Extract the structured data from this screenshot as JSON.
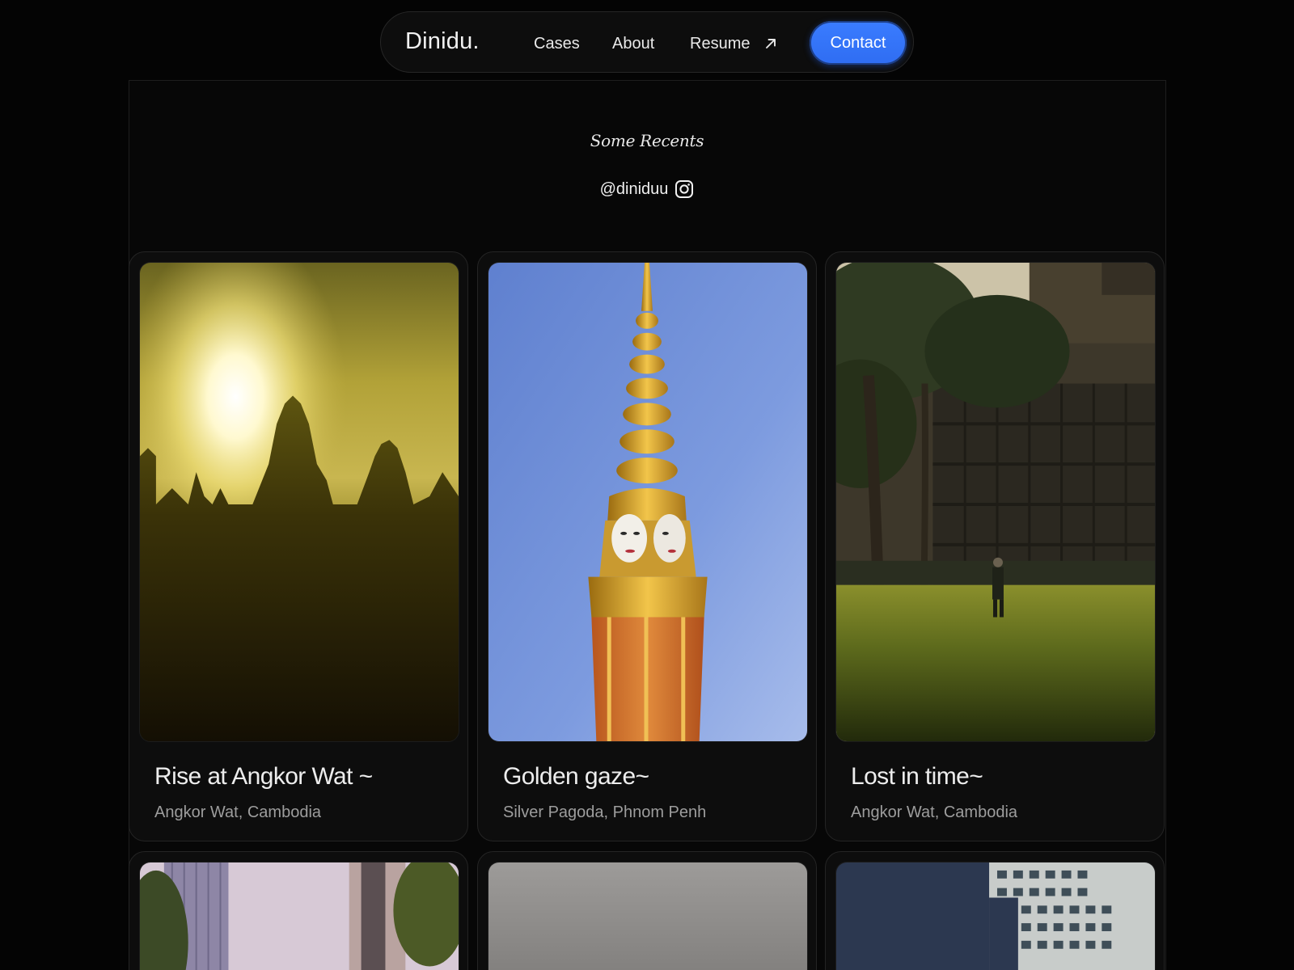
{
  "nav": {
    "brand": "Dinidu.",
    "links": [
      {
        "label": "Cases"
      },
      {
        "label": "About"
      },
      {
        "label": "Resume",
        "icon": "arrow-up-right-icon"
      }
    ],
    "contact_label": "Contact",
    "accent_color": "#3478ff"
  },
  "recents": {
    "title": "Some Recents",
    "handle": "@diniduu",
    "handle_icon": "instagram-icon"
  },
  "photos": [
    {
      "title": "Rise at Angkor Wat ~",
      "location": "Angkor Wat, Cambodia"
    },
    {
      "title": "Golden gaze~",
      "location": "Silver Pagoda, Phnom Penh"
    },
    {
      "title": "Lost in time~",
      "location": "Angkor Wat, Cambodia"
    }
  ]
}
